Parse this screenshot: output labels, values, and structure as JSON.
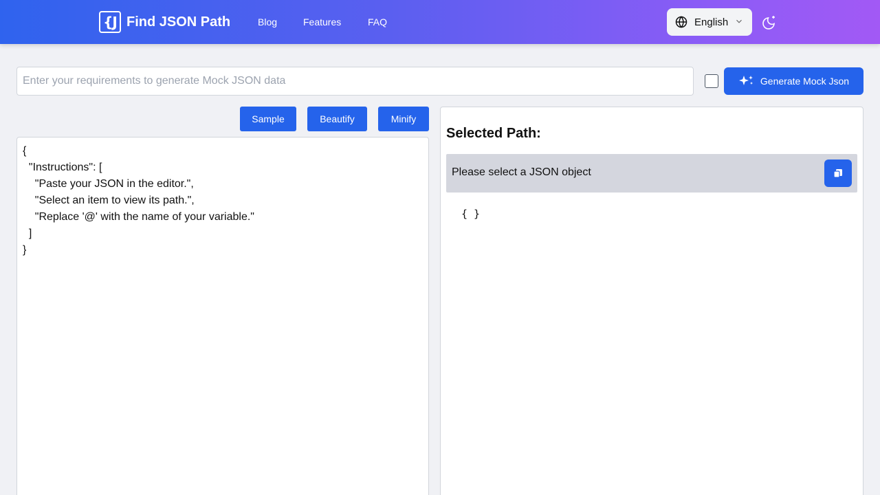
{
  "header": {
    "logo_glyph": "{J",
    "title": "Find JSON Path",
    "nav": [
      "Blog",
      "Features",
      "FAQ"
    ],
    "language": "English",
    "gradient": [
      "#2f63ee",
      "#a259f5"
    ]
  },
  "generator": {
    "placeholder": "Enter your requirements to generate Mock JSON data",
    "value": "",
    "checkbox_checked": false,
    "button_label": "Generate Mock Json",
    "button_icon": "sparkles-icon"
  },
  "toolbar": {
    "sample_label": "Sample",
    "beautify_label": "Beautify",
    "minify_label": "Minify"
  },
  "editor": {
    "content": "{\n  \"Instructions\": [\n    \"Paste your JSON in the editor.\",\n    \"Select an item to view its path.\",\n    \"Replace '@' with the name of your variable.\"\n  ]\n}"
  },
  "result": {
    "title": "Selected Path:",
    "path_text": "Please select a JSON object",
    "tree_text": "{ }",
    "copy_icon": "copy-icon"
  },
  "colors": {
    "accent": "#2563eb",
    "page_bg": "#f0f1f5",
    "path_bg": "#d4d6de"
  }
}
